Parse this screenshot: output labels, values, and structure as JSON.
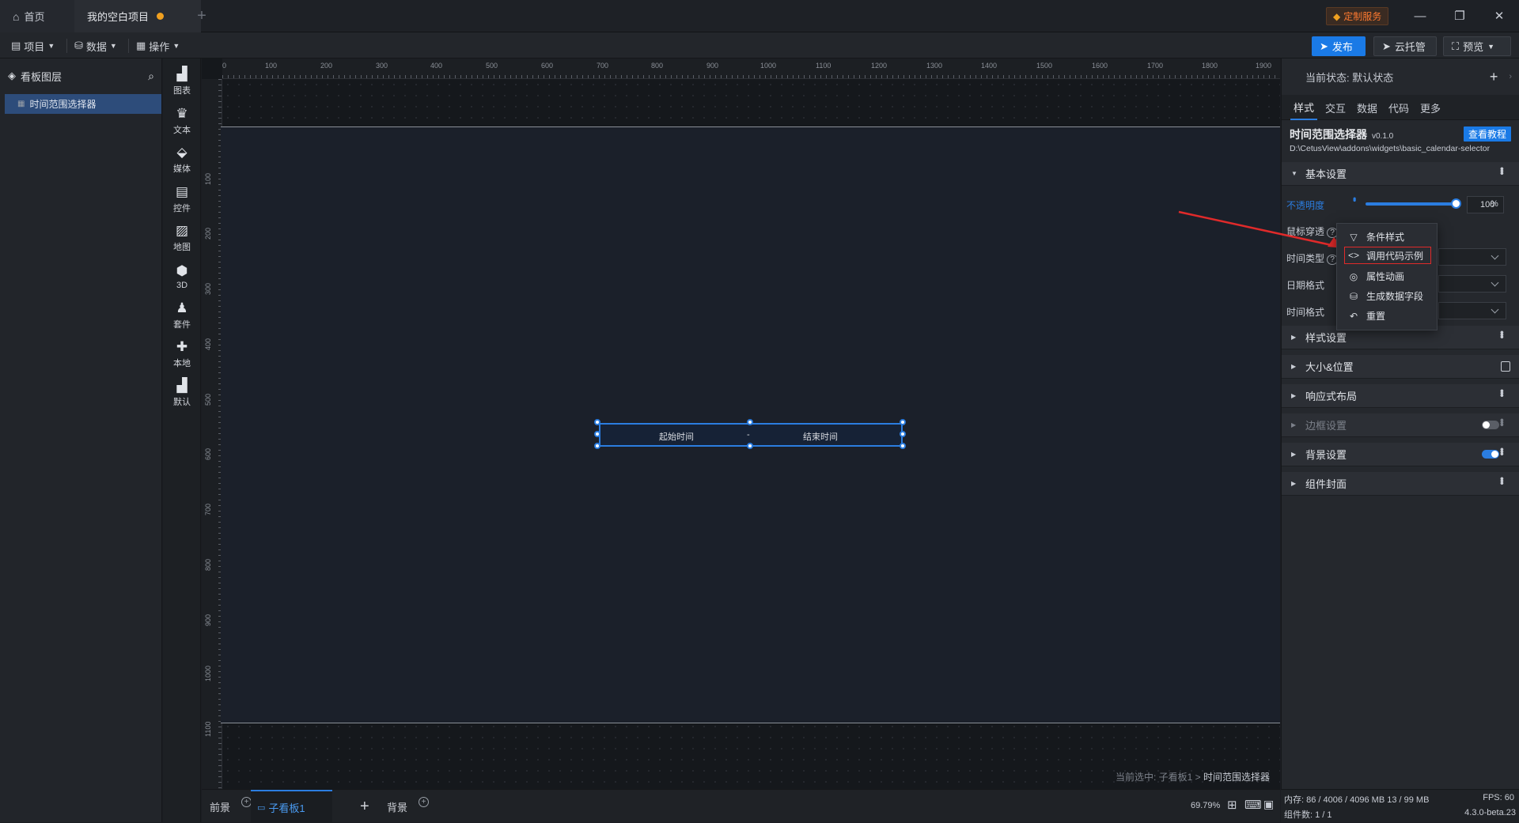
{
  "titlebar": {
    "home_tab": "首页",
    "project_tab": "我的空白项目",
    "custom_service": "定制服务"
  },
  "toolbar": {
    "menus": [
      "项目",
      "数据",
      "操作"
    ],
    "publish": "发布",
    "cloud": "云托管",
    "preview": "预览"
  },
  "layers": {
    "title": "看板图层",
    "items": [
      "时间范围选择器"
    ]
  },
  "components": [
    "图表",
    "文本",
    "媒体",
    "控件",
    "地图",
    "3D",
    "套件",
    "本地",
    "默认"
  ],
  "ruler": {
    "top_ticks": [
      "0",
      "100",
      "200",
      "300",
      "400",
      "500",
      "600",
      "700",
      "800",
      "900",
      "1000",
      "1100",
      "1200",
      "1300",
      "1400",
      "1500",
      "1600",
      "1700",
      "1800",
      "1900"
    ],
    "left_ticks": [
      "100",
      "200",
      "300",
      "400",
      "500",
      "600",
      "700",
      "800",
      "900",
      "1000",
      "1100"
    ]
  },
  "widget": {
    "start": "起始时间",
    "sep": "-",
    "end": "结束时间"
  },
  "selection": {
    "prefix": "当前选中: 子看板1 > ",
    "target": "时间范围选择器"
  },
  "bottom": {
    "front": "前景",
    "board": "子看板1",
    "background": "背景",
    "zoom": "69.79%"
  },
  "panel": {
    "state_label": "当前状态: 默认状态",
    "tabs": [
      "样式",
      "交互",
      "数据",
      "代码",
      "更多"
    ],
    "widget_name": "时间范围选择器",
    "widget_version": "v0.1.0",
    "tutorial": "查看教程",
    "path": "D:\\CetusView\\addons\\widgets\\basic_calendar-selector",
    "basic_section": "基本设置",
    "props": {
      "opacity": "不透明度",
      "opacity_value": "100",
      "opacity_fraction": 1.0,
      "pct": "%",
      "mouse": "鼠标穿透",
      "time_type": "时间类型",
      "date_format": "日期格式",
      "time_format": "时间格式"
    },
    "sections": [
      "样式设置",
      "大小&位置",
      "响应式布局",
      "边框设置",
      "背景设置",
      "组件封面"
    ]
  },
  "popup": {
    "items": [
      "条件样式",
      "调用代码示例",
      "属性动画",
      "生成数据字段",
      "重置"
    ]
  },
  "status": {
    "memory": "内存: 86 / 4006 / 4096 MB 13 / 99 MB",
    "fps": "FPS: 60",
    "count": "组件数: 1 / 1",
    "version": "4.3.0-beta.23"
  },
  "colors": {
    "accent": "#2b7de0",
    "highlight": "#e02a2a",
    "warning": "#ff7a30"
  }
}
